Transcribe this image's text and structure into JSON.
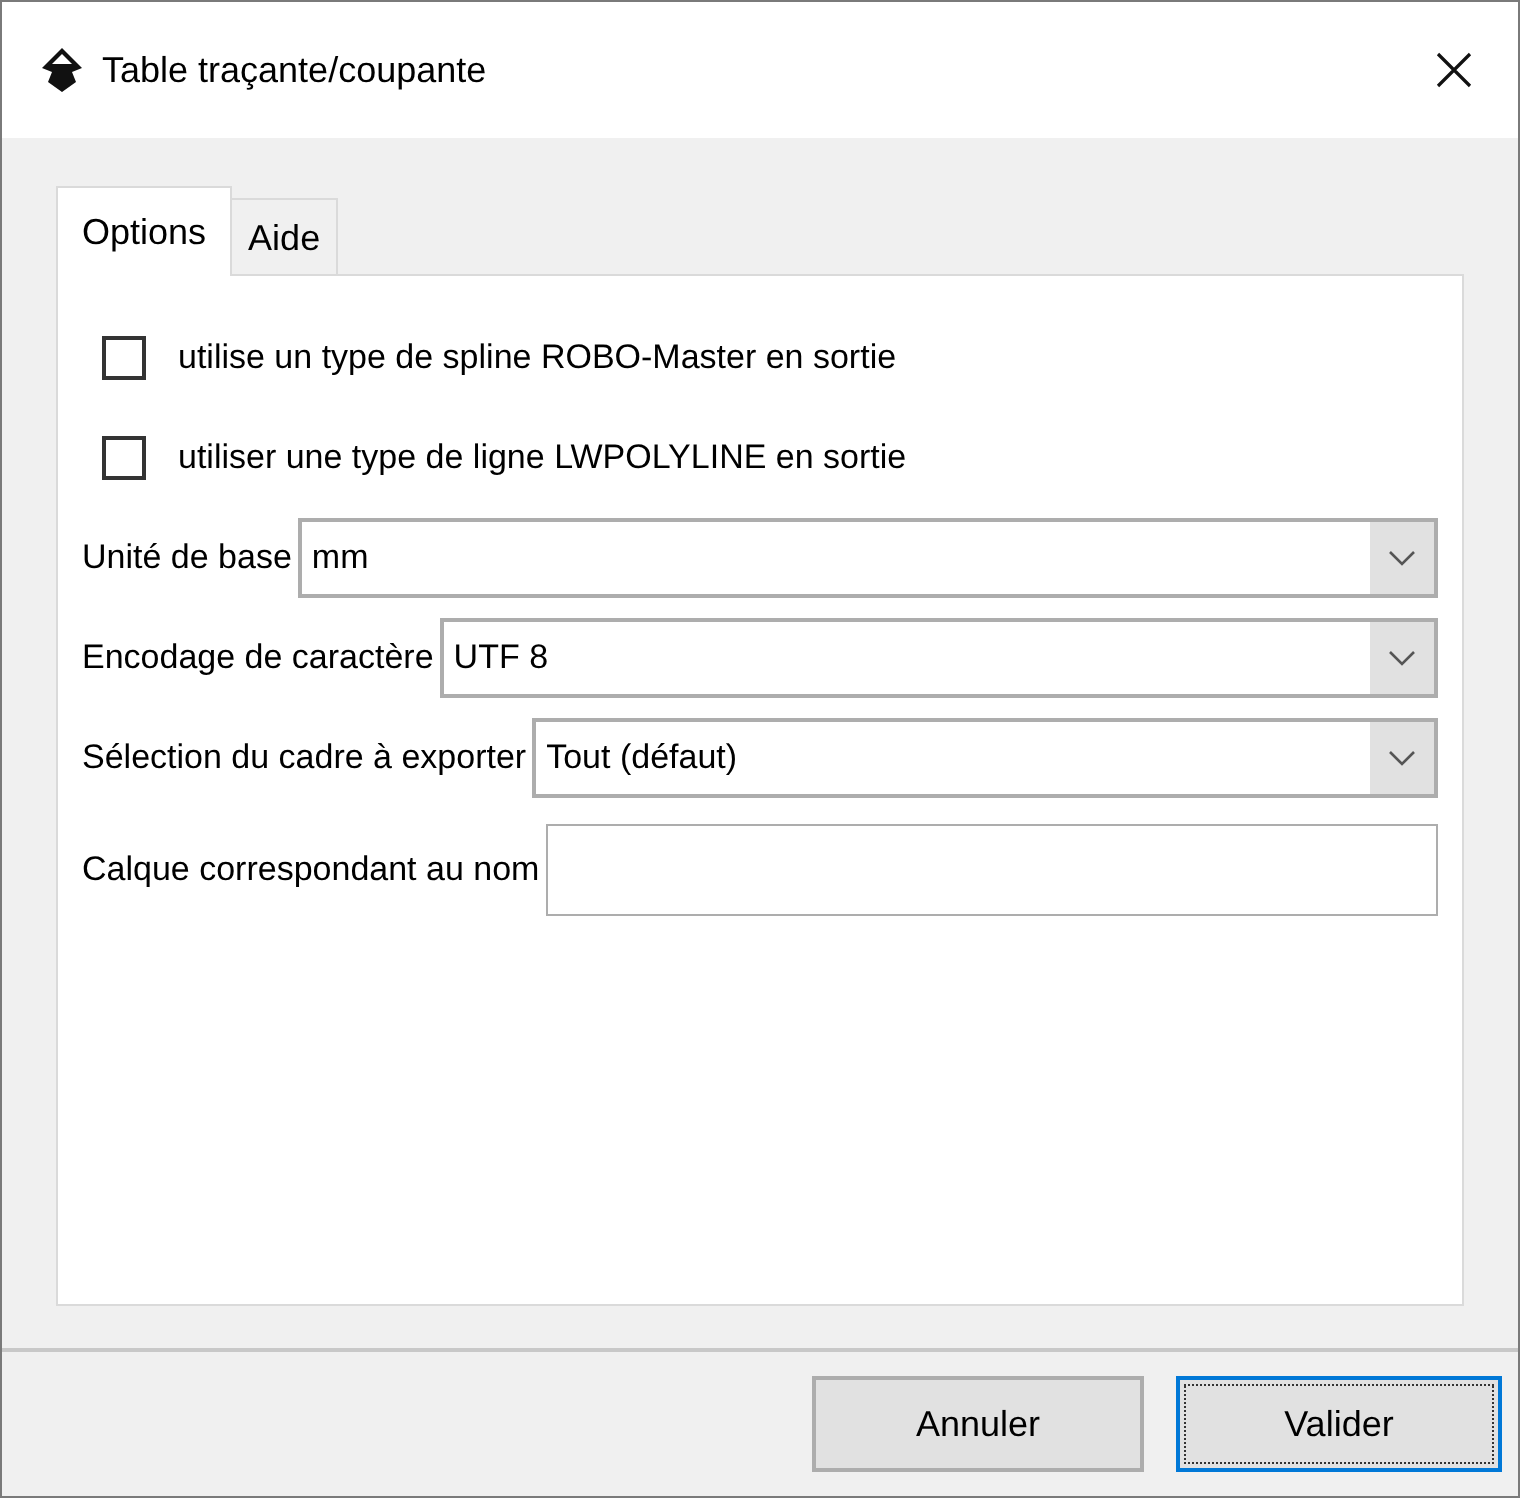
{
  "window": {
    "title": "Table traçante/coupante"
  },
  "tabs": [
    {
      "label": "Options",
      "selected": true
    },
    {
      "label": "Aide",
      "selected": false
    }
  ],
  "options": [
    {
      "kind": "checkbox",
      "label": "utilise un type de spline ROBO-Master en sortie",
      "checked": false
    },
    {
      "kind": "checkbox",
      "label": "utiliser une type de ligne LWPOLYLINE en sortie",
      "checked": false
    },
    {
      "kind": "dropdown",
      "label": "Unité de base",
      "value": "mm"
    },
    {
      "kind": "dropdown",
      "label": "Encodage de caractère",
      "value": "UTF 8"
    },
    {
      "kind": "dropdown",
      "label": "Sélection du cadre à exporter",
      "value": "Tout (défaut)"
    },
    {
      "kind": "text",
      "label": "Calque correspondant au nom"
    }
  ],
  "buttons": [
    {
      "label": "Annuler",
      "default": false
    },
    {
      "label": "Valider",
      "default": true
    }
  ]
}
